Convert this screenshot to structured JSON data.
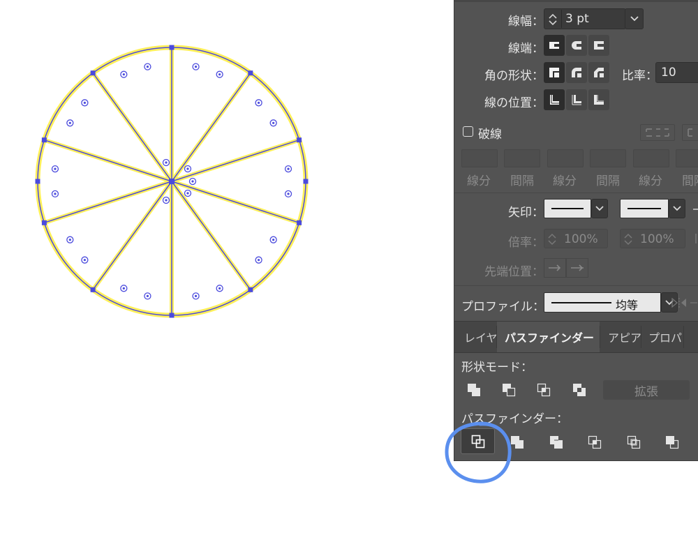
{
  "stroke": {
    "weight_label": "線幅：",
    "weight_value": "3 pt",
    "cap_label": "線端：",
    "corner_label": "角の形状：",
    "limit_label": "比率：",
    "limit_value": "10",
    "align_label": "線の位置："
  },
  "dashed": {
    "label": "破線",
    "checked": false,
    "fields": [
      "線分",
      "間隔",
      "線分",
      "間隔",
      "線分",
      "間隔"
    ]
  },
  "arrow": {
    "label": "矢印：",
    "scale_label": "倍率：",
    "scale_start": "100%",
    "scale_end": "100%",
    "tip_label": "先端位置："
  },
  "profile": {
    "label": "プロファイル：",
    "value": "均等"
  },
  "tabs": [
    "レイヤ",
    "パスファインダー",
    "アピア",
    "プロパ"
  ],
  "active_tab": "パスファインダー",
  "pathfinder": {
    "shape_modes_label": "形状モード：",
    "expand_label": "拡張",
    "pathfinders_label": "パスファインダー：",
    "highlighted_button": "divide"
  },
  "colors": {
    "panel_bg": "#535353",
    "path_stroke": "#4b4bdd",
    "selection_highlight": "#fff05a",
    "annotation_circle": "#5b8fee"
  },
  "icons": {
    "stepper": "updown-arrows-icon",
    "dropdown": "chevron-down-icon"
  }
}
